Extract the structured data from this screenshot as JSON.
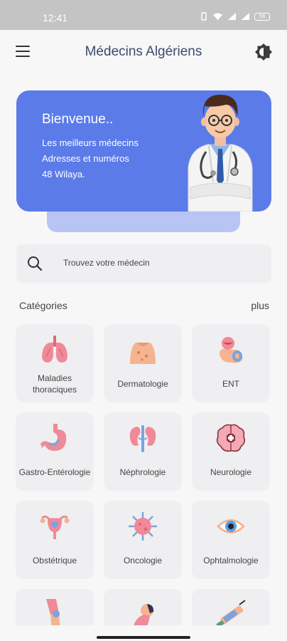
{
  "status_bar": {
    "time": "12:41",
    "battery": "56"
  },
  "app_bar": {
    "title": "Médecins Algériens"
  },
  "banner": {
    "title": "Bienvenue..",
    "lines": [
      "Les meilleurs médecins",
      "Adresses et numéros",
      "48 Wilaya."
    ]
  },
  "search": {
    "placeholder": "Trouvez votre médecin"
  },
  "categories": {
    "title": "Catégories",
    "more": "plus",
    "items": [
      {
        "label": "Maladies thoraciques",
        "icon": "lungs-icon"
      },
      {
        "label": "Dermatologie",
        "icon": "skin-icon"
      },
      {
        "label": "ENT",
        "icon": "ent-icon"
      },
      {
        "label": "Gastro-Entérologie",
        "icon": "stomach-icon"
      },
      {
        "label": "Néphrologie",
        "icon": "kidneys-icon"
      },
      {
        "label": "Neurologie",
        "icon": "brain-icon"
      },
      {
        "label": "Obstétrique",
        "icon": "uterus-icon"
      },
      {
        "label": "Oncologie",
        "icon": "cancer-cell-icon"
      },
      {
        "label": "Ophtalmologie",
        "icon": "eye-icon"
      },
      {
        "label": "",
        "icon": "knee-icon"
      },
      {
        "label": "",
        "icon": "neck-icon"
      },
      {
        "label": "",
        "icon": "syringe-icon"
      }
    ]
  },
  "colors": {
    "accent": "#5b7be9",
    "banner_shadow": "#b8c4f5",
    "card": "#efeff1"
  }
}
